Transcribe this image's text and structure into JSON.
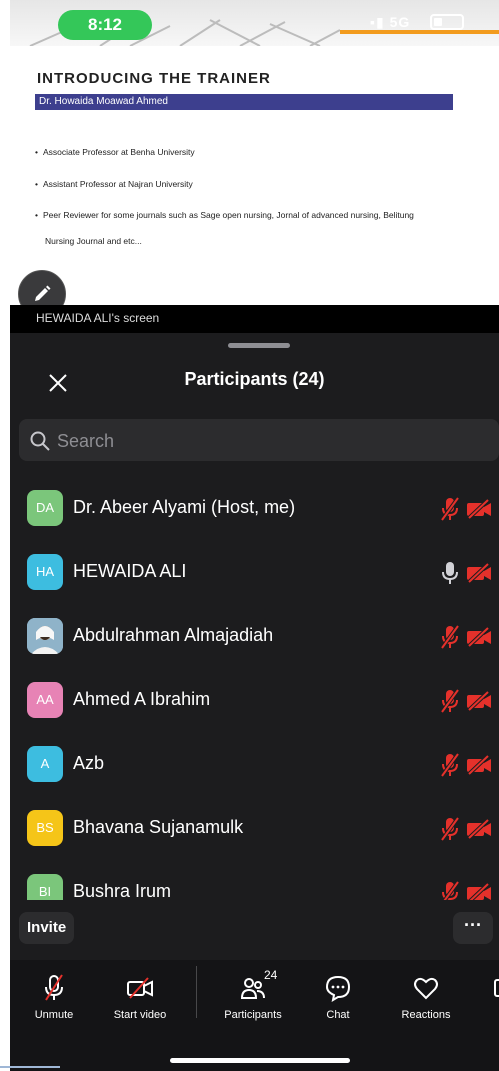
{
  "status_bar": {
    "time": "8:12",
    "network": "5G"
  },
  "slide": {
    "title": "INTRODUCING THE TRAINER",
    "subtitle": "Dr. Howaida Moawad Ahmed",
    "bullets": [
      "Associate Professor at Benha University",
      "Assistant Professor at Najran University",
      "Peer Reviewer for some journals such as Sage open nursing, Jornal of advanced nursing, Belitung",
      "Nursing Journal and etc..."
    ]
  },
  "screen_label": "HEWAIDA ALI's screen",
  "header": {
    "title": "Participants (24)"
  },
  "search": {
    "placeholder": "Search"
  },
  "participants": [
    {
      "initials": "DA",
      "name": "Dr. Abeer Alyami (Host, me)",
      "color": "#7bc67b",
      "muted": true,
      "video_off": true
    },
    {
      "initials": "HA",
      "name": "HEWAIDA ALI",
      "color": "#3dbde0",
      "muted": false,
      "video_off": true
    },
    {
      "initials": "",
      "name": "Abdulrahman Almajadiah",
      "color": "#8fb3c9",
      "muted": true,
      "video_off": true
    },
    {
      "initials": "AA",
      "name": "Ahmed A Ibrahim",
      "color": "#e783b5",
      "muted": true,
      "video_off": true
    },
    {
      "initials": "A",
      "name": "Azb",
      "color": "#3dbde0",
      "muted": true,
      "video_off": true
    },
    {
      "initials": "BS",
      "name": "Bhavana Sujanamulk",
      "color": "#f5c518",
      "muted": true,
      "video_off": true
    },
    {
      "initials": "BI",
      "name": "Bushra Irum",
      "color": "#7bc67b",
      "muted": true,
      "video_off": true
    }
  ],
  "actions": {
    "invite": "Invite",
    "more": "···"
  },
  "toolbar": {
    "unmute": "Unmute",
    "start_video": "Start video",
    "participants": "Participants",
    "participants_count": "24",
    "chat": "Chat",
    "reactions": "Reactions"
  },
  "colors": {
    "muted_red": "#e5312b",
    "green": "#34c759",
    "slide_bar": "#3d3f8e"
  }
}
